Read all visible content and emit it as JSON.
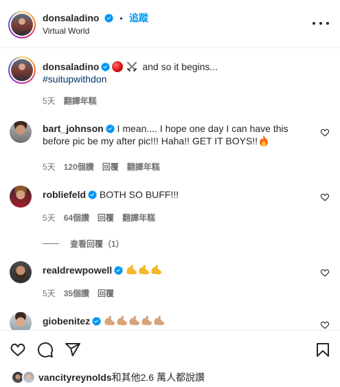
{
  "header": {
    "username": "donsaladino",
    "separator": "•",
    "follow_label": "追蹤",
    "location": "Virtual World"
  },
  "caption": {
    "username": "donsaladino",
    "text": " and so it begins...",
    "hashtag": "#suitupwithdon",
    "time": "5天",
    "translate": "翻譯年糕"
  },
  "comments": [
    {
      "username": "bart_johnson",
      "text": " I mean.... I hope one day I can have this before pic be my after pic!!! Haha!! GET IT BOYS!!",
      "time": "5天",
      "likes": "120個讚",
      "reply": "回覆",
      "translate": "翻譯年糕"
    },
    {
      "username": "robliefeld",
      "text": " BOTH SO BUFF!!!",
      "time": "5天",
      "likes": "64個讚",
      "reply": "回覆",
      "translate": "翻譯年糕"
    },
    {
      "username": "realdrewpowell",
      "text": "",
      "time": "5天",
      "likes": "35個讚",
      "reply": "回覆"
    },
    {
      "username": "giobenitez",
      "text": ""
    }
  ],
  "view_replies": "查看回覆（1）",
  "likes": {
    "lead_user": "vancityreynolds",
    "rest": "和其他2.6 萬人都說讚"
  },
  "colors": {
    "link_blue": "#0095f6",
    "hashtag": "#00376b",
    "verified": "#0095f6",
    "muted": "#737373"
  },
  "icons": [
    "verified-badge-icon",
    "more-options-icon",
    "heart-icon",
    "comment-icon",
    "share-icon",
    "bookmark-icon",
    "red-circle-emoji-icon",
    "crossed-swords-emoji-icon",
    "fire-emoji-icon",
    "flexed-biceps-emoji-icon"
  ]
}
